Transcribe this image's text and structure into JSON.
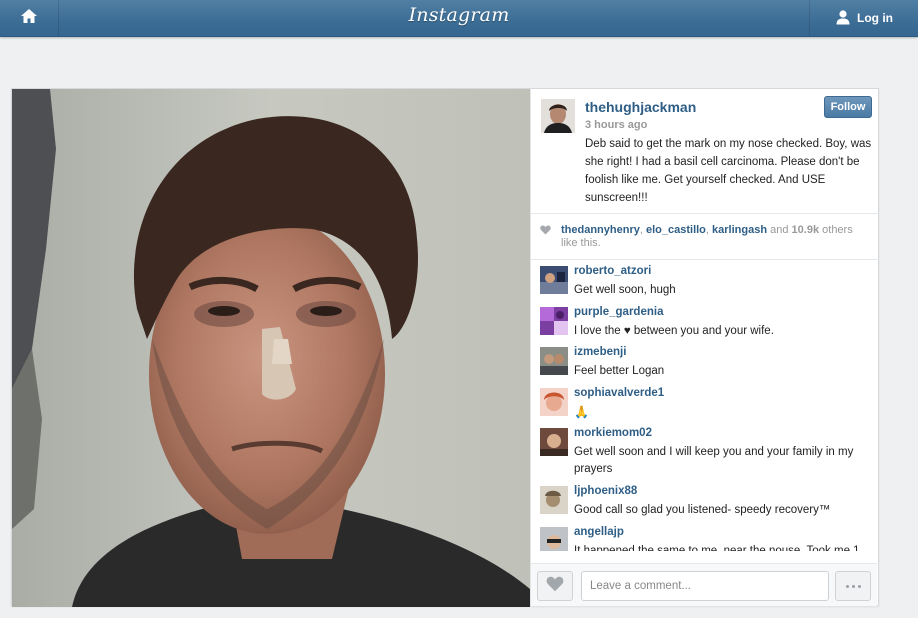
{
  "nav": {
    "home_icon": "home-icon",
    "logo": "Instagram",
    "login_icon": "user-icon",
    "login_label": "Log in"
  },
  "post": {
    "username": "thehughjackman",
    "time_ago": "3 hours ago",
    "caption": "Deb said to get the mark on my nose checked. Boy, was she right! I had a basil cell carcinoma. Please don't be foolish like me. Get yourself checked. And USE sunscreen!!!",
    "follow_label": "Follow",
    "likes": {
      "users": [
        "thedannyhenry",
        "elo_castillo",
        "karlingash"
      ],
      "and": "and",
      "count": "10.9k",
      "suffix": "others like this."
    }
  },
  "comments": [
    {
      "user": "roberto_atzori",
      "text": "Get well soon, hugh"
    },
    {
      "user": "purple_gardenia",
      "text": "I love the ♥ between you and your wife."
    },
    {
      "user": "izmebenji",
      "text": "Feel better Logan"
    },
    {
      "user": "sophiavalverde1",
      "text": "🙏"
    },
    {
      "user": "morkiemom02",
      "text": "Get well soon and I will keep you and your family in my prayers"
    },
    {
      "user": "ljphoenix88",
      "text": "Good call so glad you listened- speedy recovery™"
    },
    {
      "user": "angellajp",
      "text": "It happened the same to me, near the nouse. Took me 1"
    }
  ],
  "composer": {
    "placeholder": "Leave a comment...",
    "like_icon": "heart-icon",
    "more_icon": "more-icon"
  },
  "colors": {
    "nav_bar": "#3c6d95",
    "link": "#2e5e86",
    "background": "#eef0f2"
  }
}
